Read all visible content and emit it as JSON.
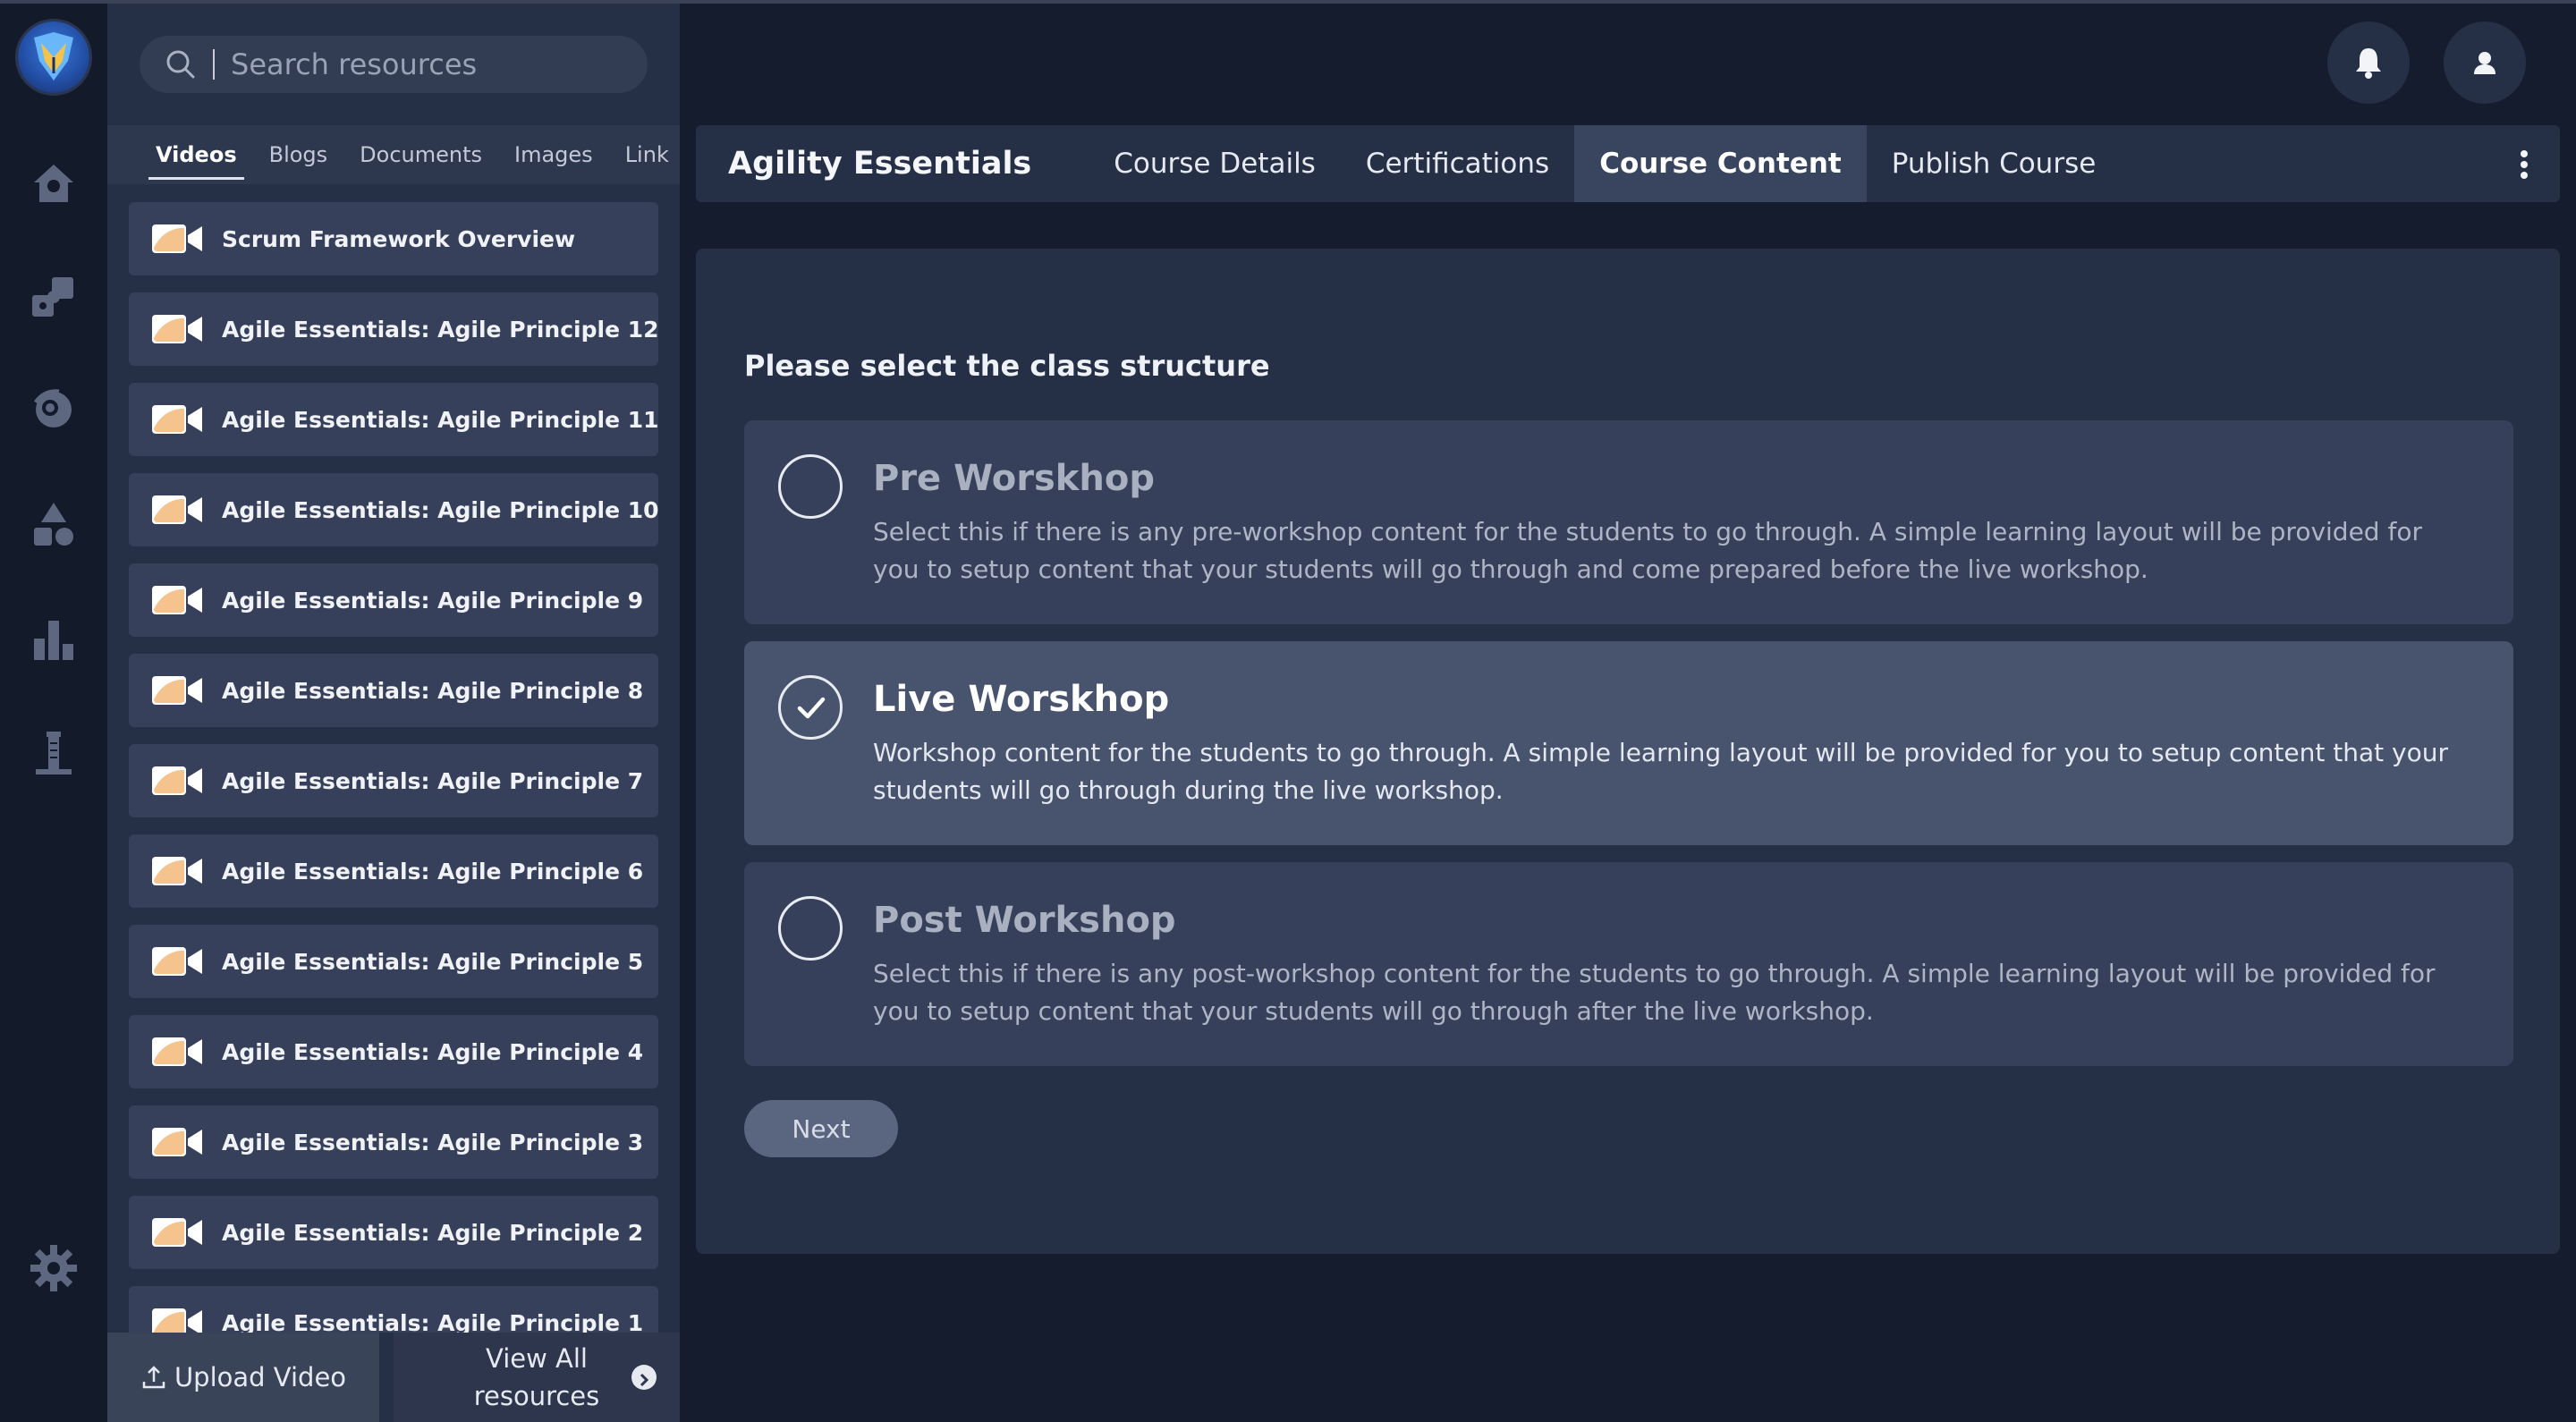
{
  "search": {
    "placeholder": "Search resources"
  },
  "resource_tabs": [
    {
      "label": "Videos",
      "active": true
    },
    {
      "label": "Blogs",
      "active": false
    },
    {
      "label": "Documents",
      "active": false
    },
    {
      "label": "Images",
      "active": false
    },
    {
      "label": "Link",
      "active": false
    }
  ],
  "resources": [
    "Scrum Framework Overview",
    "Agile Essentials: Agile Principle 12",
    "Agile Essentials: Agile Principle 11",
    "Agile Essentials: Agile Principle 10",
    "Agile Essentials: Agile Principle 9",
    "Agile Essentials: Agile Principle 8",
    "Agile Essentials: Agile Principle 7",
    "Agile Essentials: Agile Principle 6",
    "Agile Essentials: Agile Principle 5",
    "Agile Essentials: Agile Principle 4",
    "Agile Essentials: Agile Principle 3",
    "Agile Essentials: Agile Principle 2",
    "Agile Essentials: Agile Principle 1"
  ],
  "panel_footer": {
    "upload_label": "Upload Video",
    "view_all_label": "View All resources"
  },
  "course": {
    "title": "Agility Essentials",
    "tabs": [
      {
        "label": "Course Details",
        "active": false
      },
      {
        "label": "Certifications",
        "active": false
      },
      {
        "label": "Course Content",
        "active": true
      },
      {
        "label": "Publish Course",
        "active": false
      }
    ]
  },
  "content": {
    "prompt": "Please select the class structure",
    "options": [
      {
        "title": "Pre Worskhop",
        "description": "Select this if there is any pre-workshop content for the students to go through. A simple learning layout will be provided for you to setup content that your students will go through and come prepared before the live workshop.",
        "selected": false
      },
      {
        "title": "Live Worskhop",
        "description": "Workshop content for the students to go through. A simple learning layout will be provided for you to setup content that your students will go through during the live workshop.",
        "selected": true
      },
      {
        "title": "Post Workshop",
        "description": "Select this if there is any post-workshop content for the students to go through. A simple learning layout will be provided for you to setup content that your students will go through after the live workshop.",
        "selected": false
      }
    ],
    "next_label": "Next"
  },
  "icons": {
    "rail": [
      "home-icon",
      "puzzle-icon",
      "brain-icon",
      "shapes-icon",
      "bar-chart-icon",
      "tower-icon",
      "gear-icon"
    ],
    "header": [
      "bell-icon",
      "user-icon"
    ]
  },
  "colors": {
    "background": "#151c2d",
    "panel": "#252f45",
    "item": "#36405a",
    "selected": "#48536e",
    "video_icon": "#f4c38e"
  }
}
